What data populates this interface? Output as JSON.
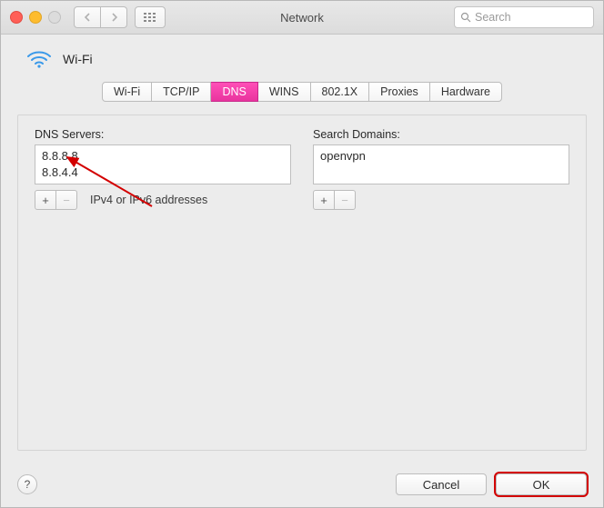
{
  "window": {
    "title": "Network"
  },
  "search": {
    "placeholder": "Search"
  },
  "interface": {
    "name": "Wi-Fi"
  },
  "tabs": {
    "t0": "Wi-Fi",
    "t1": "TCP/IP",
    "t2": "DNS",
    "t3": "WINS",
    "t4": "802.1X",
    "t5": "Proxies",
    "t6": "Hardware",
    "activeIndex": 2
  },
  "dns": {
    "label": "DNS Servers:",
    "items": {
      "i0": "8.8.8.8",
      "i1": "8.8.4.4"
    },
    "hint": "IPv4 or IPv6 addresses"
  },
  "domains": {
    "label": "Search Domains:",
    "items": {
      "i0": "openvpn"
    }
  },
  "buttons": {
    "plus": "+",
    "minus": "−",
    "help": "?",
    "cancel": "Cancel",
    "ok": "OK"
  }
}
